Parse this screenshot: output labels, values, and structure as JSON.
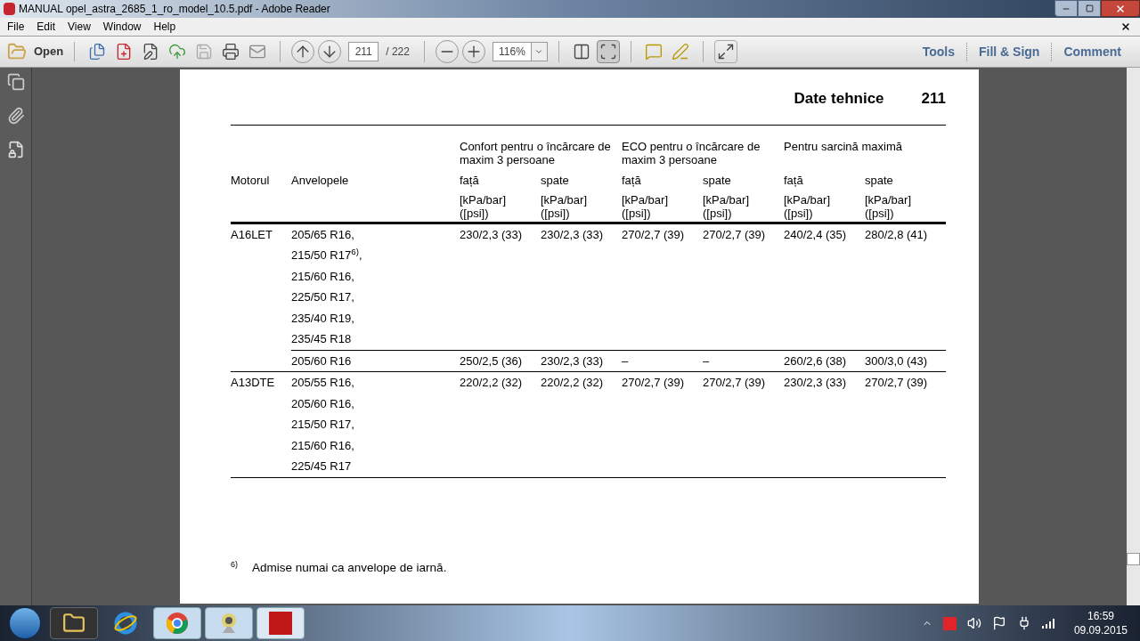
{
  "window": {
    "title": "MANUAL opel_astra_2685_1_ro_model_10.5.pdf - Adobe Reader"
  },
  "menu": [
    "File",
    "Edit",
    "View",
    "Window",
    "Help"
  ],
  "toolbar": {
    "open": "Open",
    "page": "211",
    "page_total": "/ 222",
    "zoom": "116%",
    "panels": [
      "Tools",
      "Fill & Sign",
      "Comment"
    ]
  },
  "page": {
    "section": "Date tehnice",
    "number": "211",
    "table": {
      "engine_heading": "Motorul",
      "tires_heading": "Anvelopele",
      "groups": [
        {
          "title": "Confort pentru o încărcare de maxim 3 persoane",
          "columns": [
            {
              "label": "față",
              "unit": "[kPa/bar] ([psi])"
            },
            {
              "label": "spate",
              "unit": "[kPa/bar] ([psi])"
            }
          ]
        },
        {
          "title": "ECO pentru o încărcare de maxim 3 persoane",
          "columns": [
            {
              "label": "față",
              "unit": "[kPa/bar] ([psi])"
            },
            {
              "label": "spate",
              "unit": "[kPa/bar] ([psi])"
            }
          ]
        },
        {
          "title": "Pentru sarcină maximă",
          "columns": [
            {
              "label": "față",
              "unit": "[kPa/bar] ([psi])"
            },
            {
              "label": "spate",
              "unit": "[kPa/bar] ([psi])"
            }
          ]
        }
      ],
      "rows": [
        {
          "engine": "A16LET",
          "variants": [
            {
              "tires": [
                "205/65 R16,",
                "215/50 R17$^{6)}$,",
                "215/60 R16,",
                "225/50 R17,",
                "235/40 R19,",
                "235/45 R18"
              ],
              "values": [
                "230/2,3 (33)",
                "230/2,3 (33)",
                "270/2,7 (39)",
                "270/2,7 (39)",
                "240/2,4 (35)",
                "280/2,8 (41)"
              ]
            },
            {
              "tires": [
                "205/60 R16"
              ],
              "values": [
                "250/2,5 (36)",
                "230/2,3 (33)",
                "–",
                "–",
                "260/2,6 (38)",
                "300/3,0 (43)"
              ]
            }
          ]
        },
        {
          "engine": "A13DTE",
          "variants": [
            {
              "tires": [
                "205/55 R16,",
                "205/60 R16,",
                "215/50 R17,",
                "215/60 R16,",
                "225/45 R17"
              ],
              "values": [
                "220/2,2 (32)",
                "220/2,2 (32)",
                "270/2,7 (39)",
                "270/2,7 (39)",
                "230/2,3 (33)",
                "270/2,7 (39)"
              ]
            }
          ]
        }
      ]
    },
    "footnote": {
      "mark": "6)",
      "text": "Admise numai ca anvelope de iarnă."
    }
  },
  "taskbar": {
    "time": "16:59",
    "date": "09.09.2015"
  }
}
